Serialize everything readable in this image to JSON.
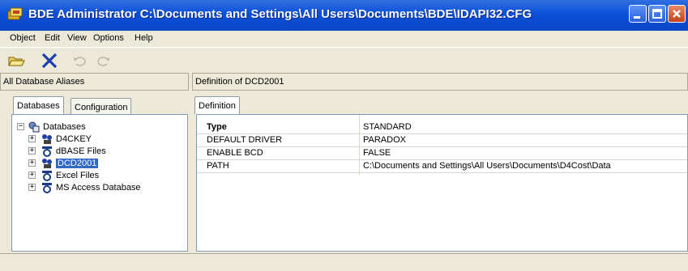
{
  "window": {
    "title": "BDE Administrator  C:\\Documents and Settings\\All Users\\Documents\\BDE\\IDAPI32.CFG"
  },
  "menu": [
    "Object",
    "Edit",
    "View",
    "Options",
    "Help"
  ],
  "toolbar": {
    "icons": [
      "open-folder-icon",
      "delete-x-icon",
      "undo-icon",
      "redo-icon"
    ]
  },
  "left_header": "All Database Aliases",
  "right_header": "Definition of DCD2001",
  "left_tabs": [
    "Databases",
    "Configuration"
  ],
  "right_tabs": [
    "Definition"
  ],
  "tree": {
    "root": "Databases",
    "items": [
      {
        "label": "D4CKEY",
        "icon": "alias-icon",
        "selected": false
      },
      {
        "label": "dBASE Files",
        "icon": "db-icon",
        "selected": false
      },
      {
        "label": "DCD2001",
        "icon": "alias-icon",
        "selected": true
      },
      {
        "label": "Excel Files",
        "icon": "db-icon",
        "selected": false
      },
      {
        "label": "MS Access Database",
        "icon": "db-icon",
        "selected": false
      }
    ]
  },
  "definition": {
    "rows": [
      {
        "name": "Type",
        "value": "STANDARD",
        "bold": true
      },
      {
        "name": "DEFAULT DRIVER",
        "value": "PARADOX",
        "bold": false
      },
      {
        "name": "ENABLE BCD",
        "value": "FALSE",
        "bold": false
      },
      {
        "name": "PATH",
        "value": "C:\\Documents and Settings\\All Users\\Documents\\D4Cost\\Data",
        "bold": false
      }
    ]
  },
  "colors": {
    "titlebar": "#0b4fd8",
    "selection": "#316ac5",
    "window_bg": "#ece9d8"
  }
}
